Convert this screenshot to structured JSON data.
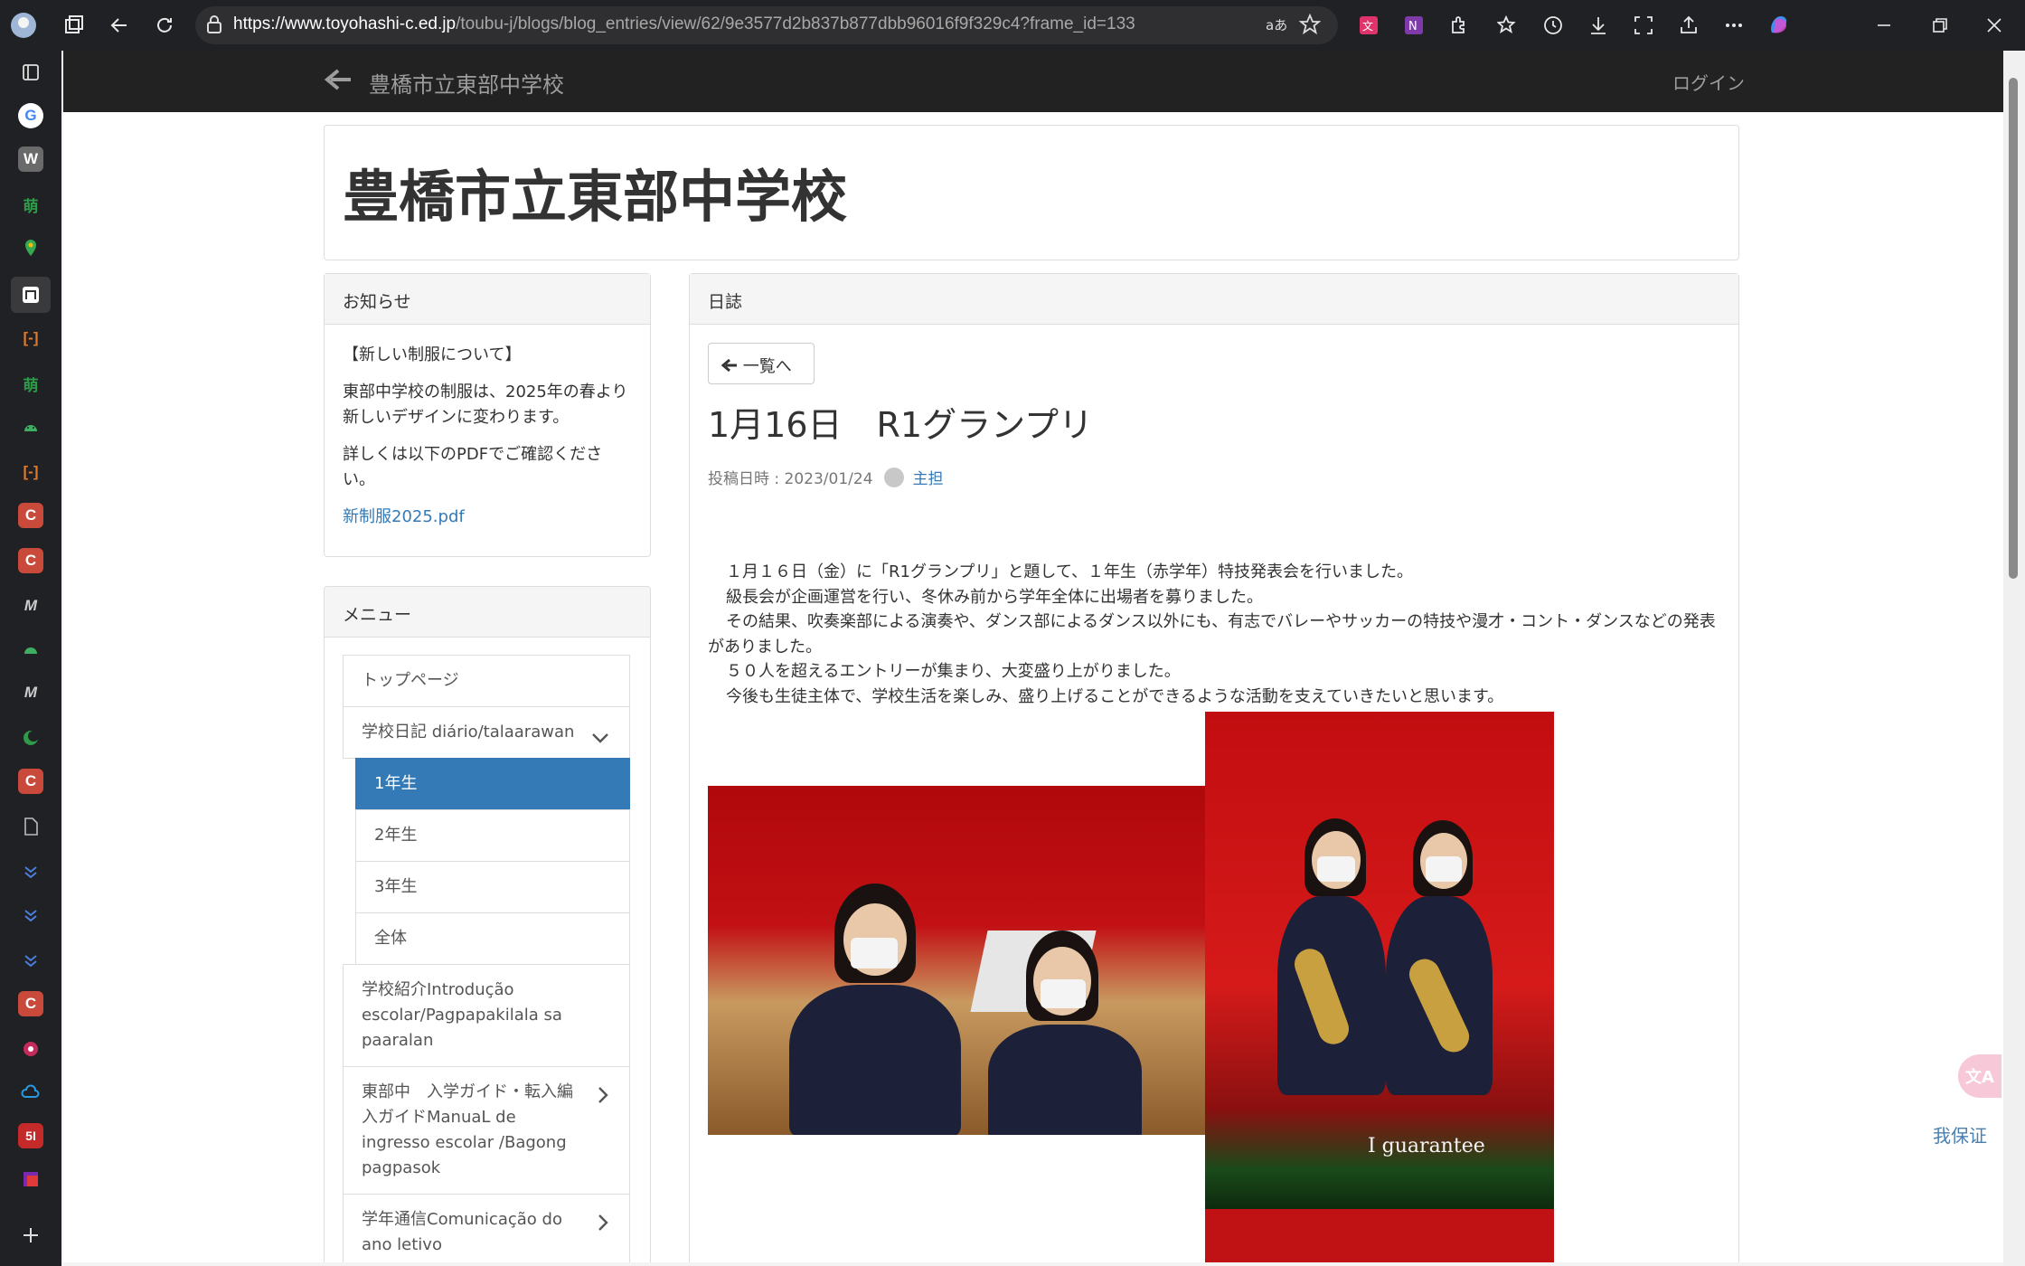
{
  "browser": {
    "url_host": "https://www.toyohashi-c.ed.jp",
    "url_path": "/toubu-j/blogs/blog_entries/view/62/9e3577d2b837b877dbb96016f9f329c4?frame_id=133"
  },
  "site": {
    "brand": "豊橋市立東部中学校",
    "login": "ログイン",
    "title": "豊橋市立東部中学校"
  },
  "notice": {
    "heading": "お知らせ",
    "line1": "【新しい制服について】",
    "line2": "東部中学校の制服は、2025年の春より新しいデザインに変わります。",
    "line3": "詳しくは以下のPDFでご確認ください。",
    "link": "新制服2025.pdf"
  },
  "menu": {
    "heading": "メニュー",
    "items": [
      {
        "label": "トップページ"
      },
      {
        "label": "学校日記 diário/talaarawan"
      },
      {
        "label": "1年生"
      },
      {
        "label": "2年生"
      },
      {
        "label": "3年生"
      },
      {
        "label": "全体"
      },
      {
        "label": "学校紹介Introdução escolar/Pagpapakilala sa paaralan"
      },
      {
        "label": "東部中　入学ガイド・転入編入ガイドManuaL de ingresso escolar /Bagong pagpasok"
      },
      {
        "label": "学年通信Comunicação do ano letivo"
      }
    ]
  },
  "diary": {
    "heading": "日誌",
    "back_button": "一覧へ",
    "title": "1月16日　R1グランプリ",
    "posted_label": "投稿日時 : 2023/01/24",
    "author": "主担",
    "paragraphs": [
      "１月１６日（金）に「R1グランプリ」と題して、１年生（赤学年）特技発表会を行いました。",
      "級長会が企画運営を行い、冬休み前から学年全体に出場者を募りました。",
      "その結果、吹奏楽部による演奏や、ダンス部によるダンス以外にも、有志でバレーやサッカーの特技や漫才・コント・ダンスなどの発表がありました。",
      "５０人を超えるエントリーが集まり、大変盛り上がりました。",
      "今後も生徒主体で、学校生活を楽しみ、盛り上げることができるような活動を支えていきたいと思います。"
    ],
    "photo_overlay_text": "I guarantee"
  },
  "overlay": {
    "translate_icon": "translate-icon",
    "stamp": "我保证"
  }
}
